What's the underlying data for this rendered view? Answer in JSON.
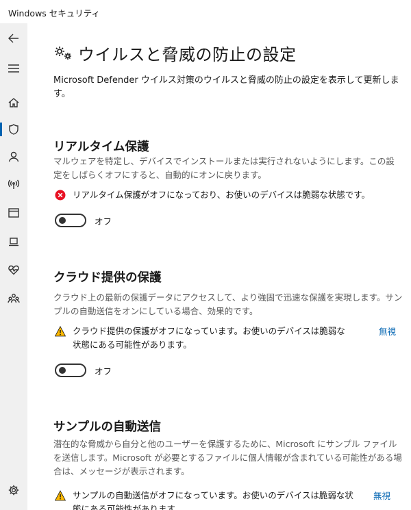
{
  "window": {
    "title": "Windows セキュリティ"
  },
  "sidebar": {
    "items": [
      {
        "name": "back",
        "icon": "back-arrow-icon"
      },
      {
        "name": "menu",
        "icon": "hamburger-icon"
      },
      {
        "name": "home",
        "icon": "home-icon"
      },
      {
        "name": "virus-protection",
        "icon": "shield-icon",
        "active": true
      },
      {
        "name": "account",
        "icon": "person-icon"
      },
      {
        "name": "firewall",
        "icon": "wireless-icon"
      },
      {
        "name": "app-browser",
        "icon": "browser-window-icon"
      },
      {
        "name": "device-security",
        "icon": "laptop-icon"
      },
      {
        "name": "device-performance",
        "icon": "heart-pulse-icon"
      },
      {
        "name": "family",
        "icon": "family-icon"
      },
      {
        "name": "settings",
        "icon": "gear-icon"
      }
    ]
  },
  "page": {
    "icon": "gear-cog-icon",
    "title": "ウイルスと脅威の防止の設定",
    "description": "Microsoft Defender ウイルス対策のウイルスと脅威の防止の設定を表示して更新します。"
  },
  "sections": {
    "realtime": {
      "title": "リアルタイム保護",
      "description": "マルウェアを特定し、デバイスでインストールまたは実行されないようにします。この設定をしばらくオフにすると、自動的にオンに戻ります。",
      "status": "リアルタイム保護がオフになっており、お使いのデバイスは脆弱な状態です。",
      "status_color": "#e81123",
      "toggle_label": "オフ"
    },
    "cloud": {
      "title": "クラウド提供の保護",
      "description": "クラウド上の最新の保護データにアクセスして、より強固で迅速な保護を実現します。サンプルの自動送信をオンにしている場合、効果的です。",
      "status": "クラウド提供の保護がオフになっています。お使いのデバイスは脆弱な状態にある可能性があります。",
      "status_color": "#ffb900",
      "dismiss": "無視",
      "toggle_label": "オフ"
    },
    "sample": {
      "title": "サンプルの自動送信",
      "description": "潜在的な脅威から自分と他のユーザーを保護するために、Microsoft にサンプル ファイルを送信します。Microsoft が必要とするファイルに個人情報が含まれている可能性がある場合は、メッセージが表示されます。",
      "status": "サンプルの自動送信がオフになっています。お使いのデバイスは脆弱な状態にある可能性があります。",
      "status_color": "#ffb900",
      "dismiss": "無視"
    }
  },
  "colors": {
    "accent": "#0063b1",
    "sidebar_bg": "#f0f0f0"
  }
}
